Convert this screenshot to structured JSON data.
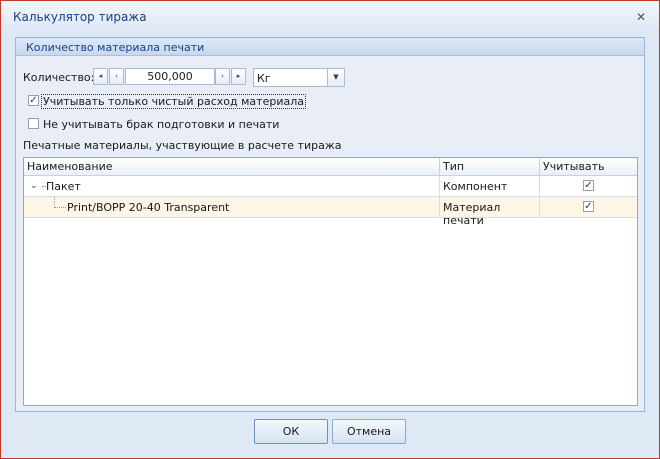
{
  "window": {
    "title": "Калькулятор тиража",
    "close_glyph": "✕"
  },
  "group": {
    "caption": "Количество материала печати"
  },
  "quantity": {
    "label": "Количество:",
    "value": "500,000",
    "unit": "Кг",
    "btn_first": "◂",
    "btn_prev": "‹",
    "btn_next": "›",
    "btn_last": "▸",
    "dropdown_glyph": "▼"
  },
  "options": {
    "net_only": {
      "label": "Учитывать только чистый расход материала",
      "checked": true
    },
    "ignore_waste": {
      "label": "Не учитывать брак подготовки и печати",
      "checked": false
    }
  },
  "grid": {
    "caption": "Печатные материалы, участвующие в расчете тиража",
    "columns": [
      "Наименование",
      "Тип",
      "Учитывать"
    ],
    "rows": [
      {
        "name": "Пакет",
        "type": "Компонент",
        "include": true,
        "expanded": true
      },
      {
        "name": "Print/BOPP 20-40 Transparent",
        "type": "Материал печати",
        "include": true
      }
    ]
  },
  "buttons": {
    "ok": "ОК",
    "cancel": "Отмена"
  },
  "colors": {
    "window_border": "#c0392b",
    "title_text": "#15428b",
    "selected_row": "#fdf6e6"
  }
}
